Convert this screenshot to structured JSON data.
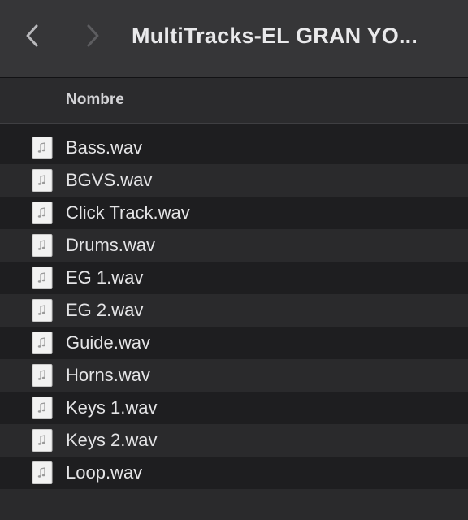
{
  "window": {
    "title": "MultiTracks-EL GRAN YO...",
    "back_icon": "chevron-left-icon",
    "forward_icon": "chevron-right-icon"
  },
  "columns": {
    "name_header": "Nombre"
  },
  "files": [
    {
      "name": "Bass.wav",
      "icon": "audio-file-icon"
    },
    {
      "name": "BGVS.wav",
      "icon": "audio-file-icon"
    },
    {
      "name": "Click Track.wav",
      "icon": "audio-file-icon"
    },
    {
      "name": "Drums.wav",
      "icon": "audio-file-icon"
    },
    {
      "name": "EG 1.wav",
      "icon": "audio-file-icon"
    },
    {
      "name": "EG 2.wav",
      "icon": "audio-file-icon"
    },
    {
      "name": "Guide.wav",
      "icon": "audio-file-icon"
    },
    {
      "name": "Horns.wav",
      "icon": "audio-file-icon"
    },
    {
      "name": "Keys 1.wav",
      "icon": "audio-file-icon"
    },
    {
      "name": "Keys 2.wav",
      "icon": "audio-file-icon"
    },
    {
      "name": "Loop.wav",
      "icon": "audio-file-icon"
    }
  ],
  "colors": {
    "toolbar": "#363638",
    "background": "#1e1e20",
    "row_alt": "#2a2a2c",
    "text": "#e4e4e6"
  }
}
